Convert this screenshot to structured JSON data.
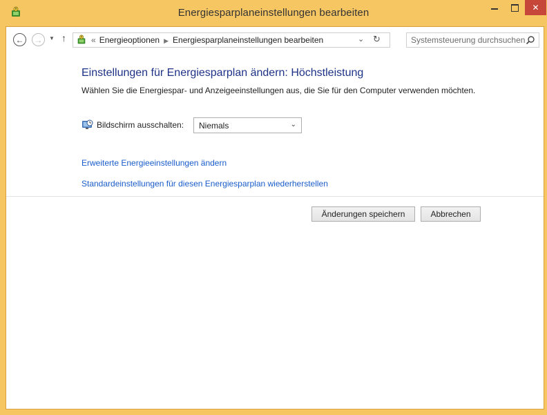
{
  "window": {
    "title": "Energiesparplaneinstellungen bearbeiten",
    "accent": "#f6c663",
    "close_color": "#c7463a"
  },
  "nav": {
    "breadcrumb_prefix": "«",
    "breadcrumbs": [
      "Energieoptionen",
      "Energiesparplaneinstellungen bearbeiten"
    ],
    "search_placeholder": "Systemsteuerung durchsuchen"
  },
  "main": {
    "heading": "Einstellungen für Energiesparplan ändern: Höchstleistung",
    "description": "Wählen Sie die Energiespar- und Anzeigeeinstellungen aus, die Sie für den Computer verwenden möchten.",
    "display_off_label": "Bildschirm ausschalten:",
    "display_off_value": "Niemals",
    "link_advanced": "Erweiterte Energieeinstellungen ändern",
    "link_restore": "Standardeinstellungen für diesen Energiesparplan wiederherstellen"
  },
  "buttons": {
    "save": "Änderungen speichern",
    "cancel": "Abbrechen"
  }
}
